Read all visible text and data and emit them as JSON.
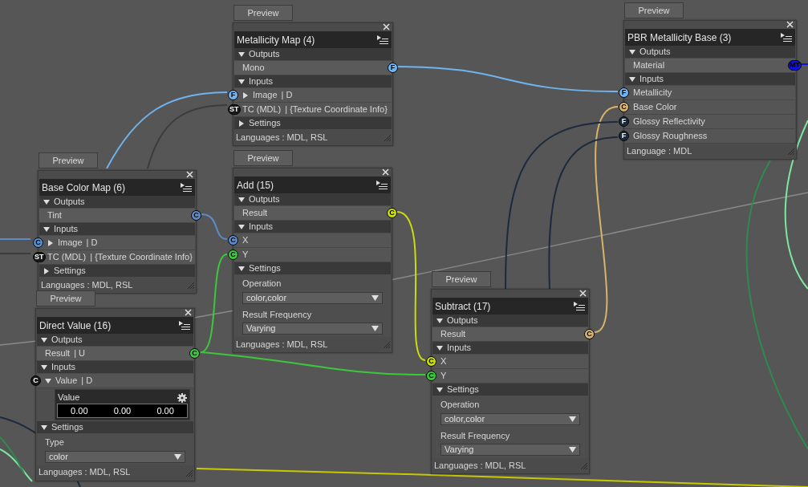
{
  "nodes": [
    {
      "preview": "Preview",
      "title": "Metallicity Map (4)",
      "sections": [
        {
          "label": "Outputs",
          "expanded": true,
          "items": [
            {
              "kind": "output",
              "label": "Mono",
              "socket": "F",
              "color": "#6fb3f0"
            }
          ]
        },
        {
          "label": "Inputs",
          "expanded": true,
          "items": [
            {
              "kind": "input",
              "label": "Image",
              "suffix": "| D",
              "expanded": false,
              "socket": "F",
              "color": "#6fb3f0"
            },
            {
              "kind": "input",
              "label": "TC (MDL)",
              "suffix": "| {Texture Coordinate Info}",
              "socket": "ST",
              "color": "#1a1a1a"
            }
          ]
        },
        {
          "label": "Settings",
          "expanded": false
        }
      ],
      "footer": "Languages : MDL, RSL"
    },
    {
      "preview": "Preview",
      "title": "PBR Metallicity Base (3)",
      "sections": [
        {
          "label": "Outputs",
          "expanded": true,
          "items": [
            {
              "kind": "output",
              "label": "Material",
              "socket": "MT",
              "color": "#1010e0"
            }
          ]
        },
        {
          "label": "Inputs",
          "expanded": true,
          "items": [
            {
              "kind": "input",
              "label": "Metallicity",
              "socket": "F",
              "color": "#6fb3f0"
            },
            {
              "kind": "input",
              "label": "Base Color",
              "socket": "C",
              "color": "#d8b46a"
            },
            {
              "kind": "input",
              "label": "Glossy Reflectivity",
              "socket": "F",
              "color": "#1c2a3c"
            },
            {
              "kind": "input",
              "label": "Glossy Roughness",
              "socket": "F",
              "color": "#1c2a3c"
            }
          ]
        }
      ],
      "footer": "Language : MDL"
    },
    {
      "preview": "Preview",
      "title": "Base Color Map (6)",
      "sections": [
        {
          "label": "Outputs",
          "expanded": true,
          "items": [
            {
              "kind": "output",
              "label": "Tint",
              "socket": "C",
              "color": "#5a8ccc"
            }
          ]
        },
        {
          "label": "Inputs",
          "expanded": true,
          "items": [
            {
              "kind": "input",
              "label": "Image",
              "suffix": "| D",
              "expanded": false,
              "socket": "C",
              "color": "#5a8ccc"
            },
            {
              "kind": "input",
              "label": "TC (MDL)",
              "suffix": "| {Texture Coordinate Info}",
              "socket": "ST",
              "color": "#1a1a1a"
            }
          ]
        },
        {
          "label": "Settings",
          "expanded": false
        }
      ],
      "footer": "Languages : MDL, RSL"
    },
    {
      "preview": "Preview",
      "title": "Add (15)",
      "sections": [
        {
          "label": "Outputs",
          "expanded": true,
          "items": [
            {
              "kind": "output",
              "label": "Result",
              "socket": "C",
              "color": "#c8dc10"
            }
          ]
        },
        {
          "label": "Inputs",
          "expanded": true,
          "items": [
            {
              "kind": "input",
              "label": "X",
              "socket": "C",
              "color": "#5a8ccc"
            },
            {
              "kind": "input",
              "label": "Y",
              "socket": "C",
              "color": "#3cc83c"
            }
          ]
        },
        {
          "label": "Settings",
          "expanded": true,
          "items": [
            {
              "kind": "setting",
              "label": "Operation",
              "value": "color,color"
            },
            {
              "kind": "setting",
              "label": "Result Frequency",
              "value": "Varying"
            }
          ]
        }
      ],
      "footer": "Languages : MDL, RSL"
    },
    {
      "preview": "Preview",
      "title": "Direct Value (16)",
      "sections": [
        {
          "label": "Outputs",
          "expanded": true,
          "items": [
            {
              "kind": "output",
              "label": "Result",
              "suffix": "| U",
              "socket": "C",
              "color": "#3cc83c"
            }
          ]
        },
        {
          "label": "Inputs",
          "expanded": true,
          "items": [
            {
              "kind": "input",
              "label": "Value",
              "suffix": "| D",
              "expanded": true,
              "socket": "C",
              "color": "#1a1a1a"
            },
            {
              "kind": "vector",
              "label": "Value",
              "values": [
                "0.00",
                "0.00",
                "0.00"
              ]
            }
          ]
        },
        {
          "label": "Settings",
          "expanded": true,
          "items": [
            {
              "kind": "setting",
              "label": "Type",
              "value": "color"
            }
          ]
        }
      ],
      "footer": "Languages : MDL, RSL"
    },
    {
      "preview": "Preview",
      "title": "Subtract (17)",
      "sections": [
        {
          "label": "Outputs",
          "expanded": true,
          "items": [
            {
              "kind": "output",
              "label": "Result",
              "socket": "C",
              "color": "#d8b46a"
            }
          ]
        },
        {
          "label": "Inputs",
          "expanded": true,
          "items": [
            {
              "kind": "input",
              "label": "X",
              "socket": "C",
              "color": "#c8dc10"
            },
            {
              "kind": "input",
              "label": "Y",
              "socket": "C",
              "color": "#3cc83c"
            }
          ]
        },
        {
          "label": "Settings",
          "expanded": true,
          "items": [
            {
              "kind": "setting",
              "label": "Operation",
              "value": "color,color"
            },
            {
              "kind": "setting",
              "label": "Result Frequency",
              "value": "Varying"
            }
          ]
        }
      ],
      "footer": "Languages : MDL, RSL"
    }
  ]
}
